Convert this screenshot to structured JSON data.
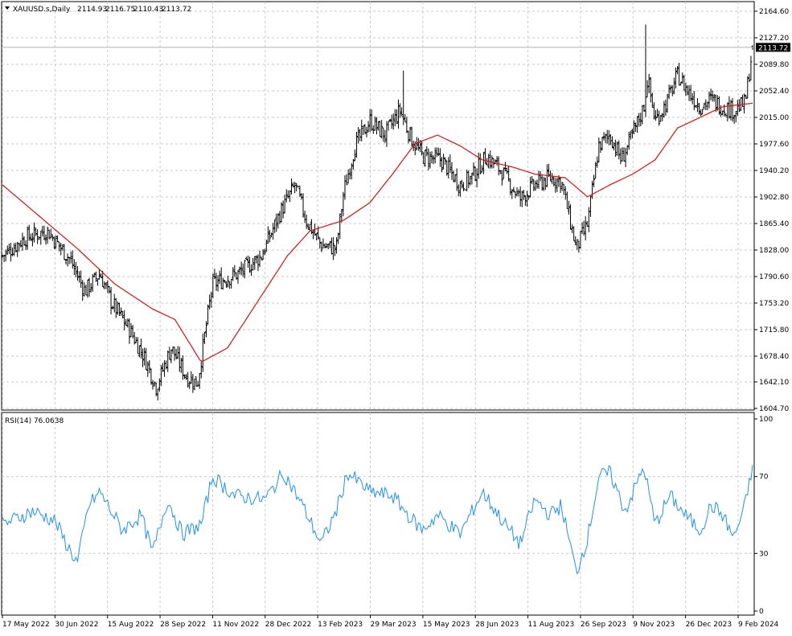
{
  "header": {
    "symbol": "XAUUSD.s,Daily",
    "open": "2114.93",
    "high": "2116.75",
    "low": "2110.43",
    "close": "2113.72"
  },
  "rsi_header": "RSI(14) 76.0638",
  "colors": {
    "background": "#ffffff",
    "grid": "#c8c8c8",
    "bars": "#000000",
    "moving_average": "#e01010",
    "rsi_line": "#1e90ff",
    "price_tag_bg": "#000000",
    "price_tag_fg": "#ffffff",
    "current_price_line": "#b0b0b0"
  },
  "chart_data": [
    {
      "type": "ohlc",
      "name": "XAUUSD.s,Daily",
      "symbol": "XAUUSD.s",
      "timeframe": "Daily",
      "current_price": "2113.72",
      "last_bar": {
        "open": 2114.93,
        "high": 2116.75,
        "low": 2110.43,
        "close": 2113.72
      },
      "ylim": [
        1604.7,
        2164.6
      ],
      "y_ticks": [
        "2164.60",
        "2127.20",
        "2089.80",
        "2052.40",
        "2015.00",
        "1977.60",
        "1940.20",
        "1902.80",
        "1865.40",
        "1828.00",
        "1790.60",
        "1753.20",
        "1715.80",
        "1678.40",
        "1642.10",
        "1604.70"
      ],
      "x_ticks": [
        "17 May 2022",
        "30 Jun 2022",
        "15 Aug 2022",
        "28 Sep 2022",
        "11 Nov 2022",
        "28 Dec 2022",
        "13 Feb 2023",
        "29 Mar 2023",
        "15 May 2023",
        "28 Jun 2023",
        "11 Aug 2023",
        "26 Sep 2023",
        "9 Nov 2023",
        "26 Dec 2023",
        "9 Feb 2024"
      ],
      "grid": true,
      "price_anchors": [
        {
          "t": 0,
          "v": 1820
        },
        {
          "t": 0.03,
          "v": 1845
        },
        {
          "t": 0.06,
          "v": 1855
        },
        {
          "t": 0.09,
          "v": 1815
        },
        {
          "t": 0.11,
          "v": 1770
        },
        {
          "t": 0.13,
          "v": 1795
        },
        {
          "t": 0.145,
          "v": 1755
        },
        {
          "t": 0.17,
          "v": 1715
        },
        {
          "t": 0.19,
          "v": 1675
        },
        {
          "t": 0.205,
          "v": 1635
        },
        {
          "t": 0.225,
          "v": 1690
        },
        {
          "t": 0.245,
          "v": 1650
        },
        {
          "t": 0.26,
          "v": 1640
        },
        {
          "t": 0.28,
          "v": 1780
        },
        {
          "t": 0.315,
          "v": 1795
        },
        {
          "t": 0.345,
          "v": 1820
        },
        {
          "t": 0.37,
          "v": 1880
        },
        {
          "t": 0.39,
          "v": 1920
        },
        {
          "t": 0.405,
          "v": 1870
        },
        {
          "t": 0.425,
          "v": 1835
        },
        {
          "t": 0.445,
          "v": 1830
        },
        {
          "t": 0.455,
          "v": 1910
        },
        {
          "t": 0.47,
          "v": 1975
        },
        {
          "t": 0.49,
          "v": 2010
        },
        {
          "t": 0.51,
          "v": 1990
        },
        {
          "t": 0.53,
          "v": 2025
        },
        {
          "t": 0.545,
          "v": 1985
        },
        {
          "t": 0.56,
          "v": 1960
        },
        {
          "t": 0.585,
          "v": 1955
        },
        {
          "t": 0.61,
          "v": 1920
        },
        {
          "t": 0.625,
          "v": 1930
        },
        {
          "t": 0.645,
          "v": 1960
        },
        {
          "t": 0.665,
          "v": 1940
        },
        {
          "t": 0.69,
          "v": 1900
        },
        {
          "t": 0.71,
          "v": 1920
        },
        {
          "t": 0.73,
          "v": 1930
        },
        {
          "t": 0.745,
          "v": 1925
        },
        {
          "t": 0.765,
          "v": 1830
        },
        {
          "t": 0.78,
          "v": 1865
        },
        {
          "t": 0.795,
          "v": 1975
        },
        {
          "t": 0.81,
          "v": 1990
        },
        {
          "t": 0.825,
          "v": 1955
        },
        {
          "t": 0.84,
          "v": 1990
        },
        {
          "t": 0.855,
          "v": 2030
        },
        {
          "t": 0.86,
          "v": 2070
        },
        {
          "t": 0.87,
          "v": 2010
        },
        {
          "t": 0.885,
          "v": 2035
        },
        {
          "t": 0.9,
          "v": 2075
        },
        {
          "t": 0.915,
          "v": 2050
        },
        {
          "t": 0.93,
          "v": 2030
        },
        {
          "t": 0.945,
          "v": 2040
        },
        {
          "t": 0.96,
          "v": 2030
        },
        {
          "t": 0.975,
          "v": 2025
        },
        {
          "t": 0.99,
          "v": 2035
        },
        {
          "t": 1.0,
          "v": 2113.72
        }
      ],
      "wick_spikes": [
        {
          "t": 0.857,
          "high": 2146
        },
        {
          "t": 0.535,
          "high": 2081
        },
        {
          "t": 0.208,
          "low": 1616
        }
      ],
      "moving_average": {
        "color": "#e01010",
        "anchors": [
          {
            "t": 0,
            "v": 1920
          },
          {
            "t": 0.05,
            "v": 1875
          },
          {
            "t": 0.1,
            "v": 1830
          },
          {
            "t": 0.15,
            "v": 1780
          },
          {
            "t": 0.2,
            "v": 1745
          },
          {
            "t": 0.23,
            "v": 1730
          },
          {
            "t": 0.265,
            "v": 1670
          },
          {
            "t": 0.3,
            "v": 1690
          },
          {
            "t": 0.34,
            "v": 1755
          },
          {
            "t": 0.38,
            "v": 1820
          },
          {
            "t": 0.41,
            "v": 1855
          },
          {
            "t": 0.455,
            "v": 1870
          },
          {
            "t": 0.49,
            "v": 1895
          },
          {
            "t": 0.52,
            "v": 1935
          },
          {
            "t": 0.55,
            "v": 1978
          },
          {
            "t": 0.58,
            "v": 1990
          },
          {
            "t": 0.61,
            "v": 1975
          },
          {
            "t": 0.64,
            "v": 1955
          },
          {
            "t": 0.68,
            "v": 1945
          },
          {
            "t": 0.71,
            "v": 1935
          },
          {
            "t": 0.75,
            "v": 1930
          },
          {
            "t": 0.78,
            "v": 1903
          },
          {
            "t": 0.81,
            "v": 1920
          },
          {
            "t": 0.84,
            "v": 1935
          },
          {
            "t": 0.87,
            "v": 1955
          },
          {
            "t": 0.9,
            "v": 2000
          },
          {
            "t": 0.93,
            "v": 2015
          },
          {
            "t": 0.96,
            "v": 2030
          },
          {
            "t": 1.0,
            "v": 2035
          }
        ]
      }
    },
    {
      "type": "line",
      "name": "RSI(14)",
      "last_value": "76.0638",
      "ylim": [
        0,
        100
      ],
      "y_ticks": [
        "100",
        "70",
        "30",
        "0"
      ],
      "color": "#1e90ff",
      "anchors": [
        {
          "t": 0,
          "v": 45
        },
        {
          "t": 0.04,
          "v": 52
        },
        {
          "t": 0.07,
          "v": 47
        },
        {
          "t": 0.085,
          "v": 35
        },
        {
          "t": 0.1,
          "v": 25
        },
        {
          "t": 0.115,
          "v": 55
        },
        {
          "t": 0.13,
          "v": 62
        },
        {
          "t": 0.16,
          "v": 42
        },
        {
          "t": 0.185,
          "v": 50
        },
        {
          "t": 0.2,
          "v": 30
        },
        {
          "t": 0.22,
          "v": 58
        },
        {
          "t": 0.24,
          "v": 40
        },
        {
          "t": 0.265,
          "v": 45
        },
        {
          "t": 0.28,
          "v": 70
        },
        {
          "t": 0.31,
          "v": 60
        },
        {
          "t": 0.35,
          "v": 58
        },
        {
          "t": 0.375,
          "v": 72
        },
        {
          "t": 0.4,
          "v": 55
        },
        {
          "t": 0.425,
          "v": 35
        },
        {
          "t": 0.445,
          "v": 52
        },
        {
          "t": 0.46,
          "v": 72
        },
        {
          "t": 0.49,
          "v": 62
        },
        {
          "t": 0.52,
          "v": 60
        },
        {
          "t": 0.545,
          "v": 48
        },
        {
          "t": 0.56,
          "v": 42
        },
        {
          "t": 0.58,
          "v": 50
        },
        {
          "t": 0.61,
          "v": 40
        },
        {
          "t": 0.64,
          "v": 62
        },
        {
          "t": 0.67,
          "v": 45
        },
        {
          "t": 0.69,
          "v": 35
        },
        {
          "t": 0.71,
          "v": 58
        },
        {
          "t": 0.73,
          "v": 50
        },
        {
          "t": 0.745,
          "v": 55
        },
        {
          "t": 0.765,
          "v": 20
        },
        {
          "t": 0.78,
          "v": 38
        },
        {
          "t": 0.795,
          "v": 70
        },
        {
          "t": 0.81,
          "v": 72
        },
        {
          "t": 0.83,
          "v": 52
        },
        {
          "t": 0.855,
          "v": 75
        },
        {
          "t": 0.87,
          "v": 45
        },
        {
          "t": 0.89,
          "v": 60
        },
        {
          "t": 0.91,
          "v": 50
        },
        {
          "t": 0.93,
          "v": 42
        },
        {
          "t": 0.945,
          "v": 55
        },
        {
          "t": 0.96,
          "v": 50
        },
        {
          "t": 0.975,
          "v": 38
        },
        {
          "t": 0.99,
          "v": 55
        },
        {
          "t": 1.0,
          "v": 76.0638
        }
      ]
    }
  ]
}
